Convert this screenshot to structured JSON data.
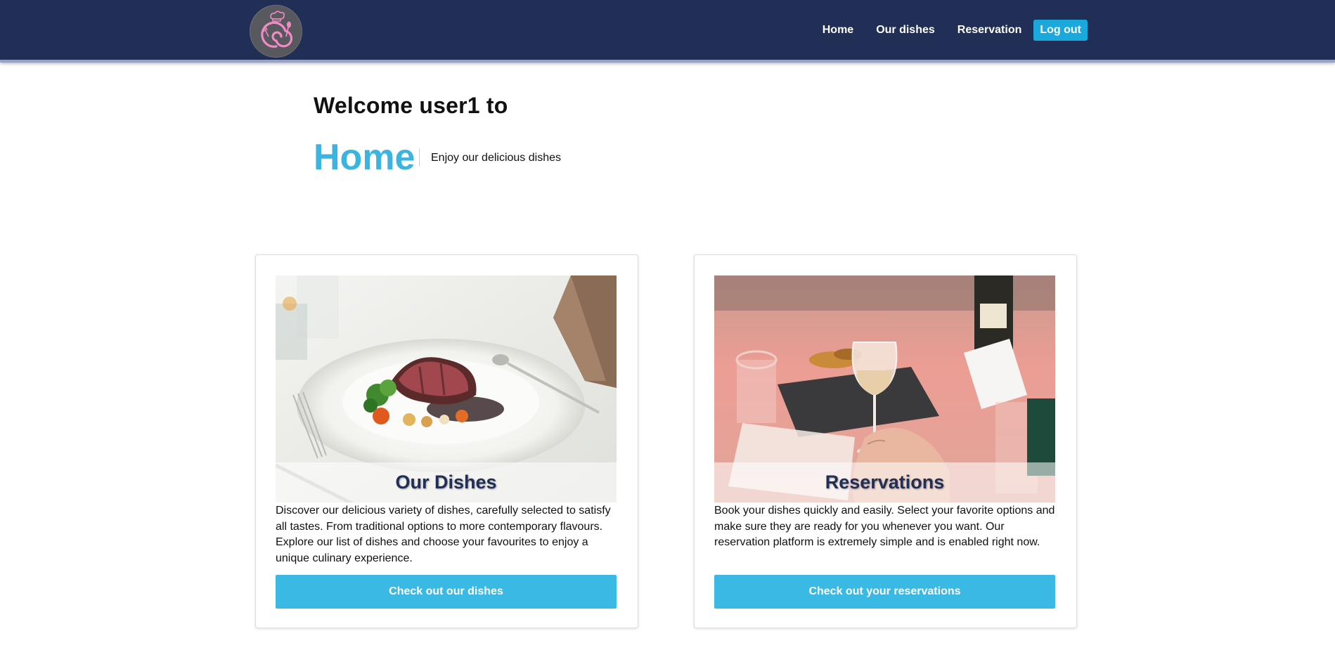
{
  "nav": {
    "logo_icon": "chef-logo-icon",
    "links": [
      "Home",
      "Our dishes",
      "Reservation"
    ],
    "logout_label": "Log out"
  },
  "hero": {
    "welcome": "Welcome user1 to",
    "title": "Home",
    "subtitle": "Enjoy our delicious dishes"
  },
  "cards": [
    {
      "title": "Our Dishes",
      "text": "Discover our delicious variety of dishes, carefully selected to satisfy all tastes. From traditional options to more contemporary flavours. Explore our list of dishes and choose your favourites to enjoy a unique culinary experience.",
      "button": "Check out our dishes"
    },
    {
      "title": "Reservations",
      "text": "Book your dishes quickly and easily. Select your favorite options and make sure they are ready for you whenever you want. Our reservation platform is extremely simple and is enabled right now.",
      "button": "Check out your reservations"
    }
  ],
  "colors": {
    "navbar": "#212e55",
    "accent": "#3bb9e5",
    "hero_title": "#3cb4e0"
  }
}
